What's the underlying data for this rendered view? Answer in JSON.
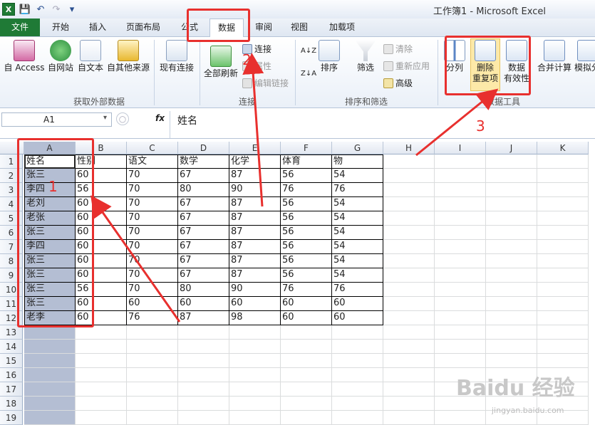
{
  "window": {
    "title": "工作簿1 - Microsoft Excel",
    "app_icon_letter": "X"
  },
  "tabs": [
    "文件",
    "开始",
    "插入",
    "页面布局",
    "公式",
    "数据",
    "审阅",
    "视图",
    "加载项"
  ],
  "active_tab": "数据",
  "ribbon": {
    "get_external": {
      "label": "获取外部数据",
      "buttons": [
        "自 Access",
        "自网站",
        "自文本",
        "自其他来源"
      ],
      "existing": "现有连接"
    },
    "connections": {
      "label": "连接",
      "refresh": "全部刷新",
      "items": [
        "连接",
        "属性",
        "编辑链接"
      ]
    },
    "sort_filter": {
      "label": "排序和筛选",
      "sort": "排序",
      "filter": "筛选",
      "items": [
        "清除",
        "重新应用",
        "高级"
      ]
    },
    "data_tools": {
      "label": "数据工具",
      "split": "分列",
      "remove_dup_1": "删除",
      "remove_dup_2": "重复项",
      "validation_1": "数据",
      "validation_2": "有效性",
      "merge": "合并计算",
      "whatif": "模拟分"
    }
  },
  "formula_bar": {
    "name_box": "A1",
    "fx": "fx",
    "value": "姓名"
  },
  "columns": [
    "A",
    "B",
    "C",
    "D",
    "E",
    "F",
    "G",
    "H",
    "I",
    "J",
    "K"
  ],
  "row_numbers": [
    "1",
    "2",
    "3",
    "4",
    "5",
    "6",
    "7",
    "8",
    "9",
    "10",
    "11",
    "12",
    "13",
    "14",
    "15",
    "16",
    "17",
    "18",
    "19"
  ],
  "sheet": {
    "header": [
      "姓名",
      "性别",
      "语文",
      "数学",
      "化学",
      "体育",
      "物"
    ],
    "rows": [
      [
        "张三",
        "60",
        "70",
        "67",
        "87",
        "56",
        "54"
      ],
      [
        "李四",
        "56",
        "70",
        "80",
        "90",
        "76",
        "76"
      ],
      [
        "老刘",
        "60",
        "70",
        "67",
        "87",
        "56",
        "54"
      ],
      [
        "老张",
        "60",
        "70",
        "67",
        "87",
        "56",
        "54"
      ],
      [
        "张三",
        "60",
        "70",
        "67",
        "87",
        "56",
        "54"
      ],
      [
        "李四",
        "60",
        "70",
        "67",
        "87",
        "56",
        "54"
      ],
      [
        "张三",
        "60",
        "70",
        "67",
        "87",
        "56",
        "54"
      ],
      [
        "张三",
        "60",
        "70",
        "67",
        "87",
        "56",
        "54"
      ],
      [
        "张三",
        "56",
        "70",
        "80",
        "90",
        "76",
        "76"
      ],
      [
        "张三",
        "60",
        "60",
        "60",
        "60",
        "60",
        "60"
      ],
      [
        "老李",
        "60",
        "76",
        "87",
        "98",
        "60",
        "60"
      ]
    ]
  },
  "annotations": [
    "1",
    "2",
    "3"
  ],
  "watermark": {
    "main": "Baidu 经验",
    "sub": "jingyan.baidu.com"
  },
  "colors": {
    "annotation": "#e8302e",
    "file_tab": "#1f7a36",
    "selection": "#b4bed3"
  }
}
